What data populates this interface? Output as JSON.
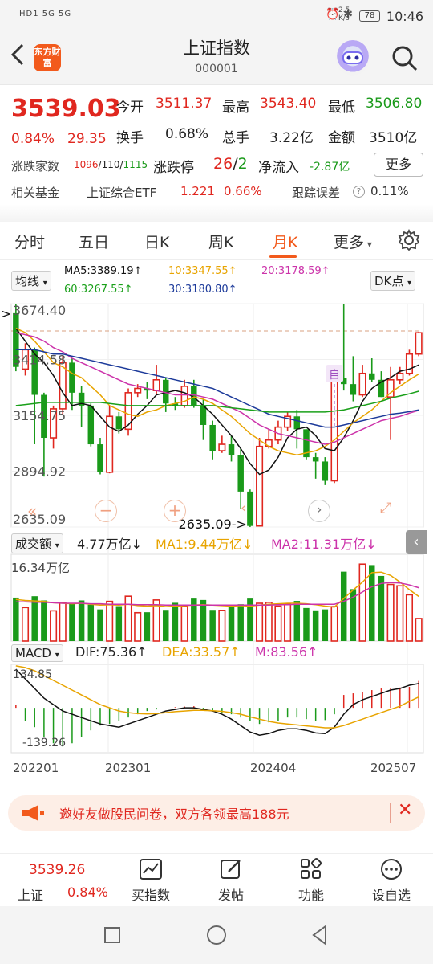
{
  "status": {
    "signal": "HD1 5G  5G",
    "speed": "2.5 K/s",
    "battery": "78",
    "time": "10:46"
  },
  "header": {
    "logo_text": "东方财富",
    "title": "上证指数",
    "code": "000001"
  },
  "quote": {
    "price": "3539.03",
    "change_pct": "0.84%",
    "change": "29.35",
    "open_label": "今开",
    "open": "3511.37",
    "high_label": "最高",
    "high": "3543.40",
    "low_label": "最低",
    "low": "3506.80",
    "turnover_label": "换手",
    "turnover": "0.68%",
    "volume_label": "总手",
    "volume": "3.22亿",
    "amount_label": "金额",
    "amount": "3510亿",
    "breadth_label": "涨跌家数",
    "breadth_up": "1096",
    "breadth_flat": "110",
    "breadth_down": "1115",
    "limit_label": "涨跌停",
    "limit_up": "26",
    "limit_down": "2",
    "netflow_label": "净流入",
    "netflow": "-2.87亿",
    "more_label": "更多"
  },
  "fund_row": {
    "label": "相关基金",
    "fund_name": "上证综合ETF",
    "fund_price": "1.221",
    "fund_pct": "0.66%",
    "track_label": "跟踪误差",
    "track_value": "0.11%"
  },
  "tabs": [
    {
      "label": "分时",
      "active": false
    },
    {
      "label": "五日",
      "active": false
    },
    {
      "label": "日K",
      "active": false
    },
    {
      "label": "周K",
      "active": false
    },
    {
      "label": "月K",
      "active": true
    },
    {
      "label": "更多",
      "active": false
    }
  ],
  "chart_controls": {
    "indicator_select": "均线",
    "dk_label": "DK点",
    "ma5": "MA5:3389.19↑",
    "ma10": "10:3347.55↑",
    "ma20": "20:3178.59↑",
    "ma60": "60:3267.55↑",
    "ma30": "30:3180.80↑",
    "marker": "自",
    "high_annotation": "3674.40->",
    "low_annotation": "2635.09->"
  },
  "volume_panel": {
    "select": "成交额",
    "value": "4.77万亿↓",
    "ma1": "MA1:9.44万亿↓",
    "ma2": "MA2:11.31万亿↓",
    "axis_top": "16.34万亿"
  },
  "macd_panel": {
    "select": "MACD",
    "dif": "DIF:75.36↑",
    "dea": "DEA:33.57↑",
    "m": "M:83.56↑",
    "axis_top": "134.85",
    "axis_bottom": "-139.26"
  },
  "banner": {
    "text": "邀好友做股民问卷，双方各领最高188元"
  },
  "bottom_nav": {
    "index_price": "3539.26",
    "index_name": "上证",
    "index_pct": "0.84%",
    "items": [
      {
        "label": "买指数",
        "icon": "chart-icon"
      },
      {
        "label": "发帖",
        "icon": "edit-icon"
      },
      {
        "label": "功能",
        "icon": "grid-icon"
      },
      {
        "label": "设自选",
        "icon": "more-icon"
      }
    ]
  },
  "colors": {
    "up": "#e0271f",
    "down": "#1a9a1a",
    "accent": "#f25a1c",
    "ma5": "#111111",
    "ma10": "#e8a400",
    "ma20": "#cc33aa",
    "ma30": "#1c3a9a",
    "ma60": "#1aa01a"
  },
  "chart_data": {
    "type": "candlestick",
    "title": "",
    "period": "monthly",
    "ylim": [
      2635.09,
      3674.4
    ],
    "y_ticks": [
      "3674.40",
      "3414.58",
      "3154.75",
      "2894.92",
      "2635.09"
    ],
    "x_ticks": [
      "202201",
      "202301",
      "202404",
      "202507"
    ],
    "candles": [
      {
        "o": 3630,
        "c": 3380,
        "h": 3674,
        "l": 3360
      },
      {
        "o": 3370,
        "c": 3460,
        "h": 3490,
        "l": 3340
      },
      {
        "o": 3460,
        "c": 3250,
        "h": 3470,
        "l": 3020
      },
      {
        "o": 3250,
        "c": 3050,
        "h": 3260,
        "l": 2870
      },
      {
        "o": 3050,
        "c": 3185,
        "h": 3200,
        "l": 3000
      },
      {
        "o": 3185,
        "c": 3400,
        "h": 3430,
        "l": 3160
      },
      {
        "o": 3400,
        "c": 3260,
        "h": 3420,
        "l": 3180
      },
      {
        "o": 3260,
        "c": 3200,
        "h": 3290,
        "l": 3100
      },
      {
        "o": 3200,
        "c": 3020,
        "h": 3210,
        "l": 3010
      },
      {
        "o": 3020,
        "c": 2890,
        "h": 3050,
        "l": 2880
      },
      {
        "o": 2890,
        "c": 3150,
        "h": 3200,
        "l": 2885
      },
      {
        "o": 3150,
        "c": 3090,
        "h": 3170,
        "l": 3070
      },
      {
        "o": 3090,
        "c": 3260,
        "h": 3280,
        "l": 3060
      },
      {
        "o": 3260,
        "c": 3280,
        "h": 3300,
        "l": 3240
      },
      {
        "o": 3280,
        "c": 3270,
        "h": 3310,
        "l": 3230
      },
      {
        "o": 3270,
        "c": 3320,
        "h": 3390,
        "l": 3250
      },
      {
        "o": 3320,
        "c": 3210,
        "h": 3330,
        "l": 3170
      },
      {
        "o": 3210,
        "c": 3200,
        "h": 3240,
        "l": 3180
      },
      {
        "o": 3200,
        "c": 3290,
        "h": 3320,
        "l": 3190
      },
      {
        "o": 3290,
        "c": 3200,
        "h": 3320,
        "l": 3190
      },
      {
        "o": 3200,
        "c": 3110,
        "h": 3230,
        "l": 3040
      },
      {
        "o": 3110,
        "c": 2990,
        "h": 3130,
        "l": 2950
      },
      {
        "o": 2990,
        "c": 3020,
        "h": 3060,
        "l": 2980
      },
      {
        "o": 3020,
        "c": 2970,
        "h": 3060,
        "l": 2940
      },
      {
        "o": 2970,
        "c": 2800,
        "h": 3000,
        "l": 2720
      },
      {
        "o": 2800,
        "c": 2640,
        "h": 2810,
        "l": 2635
      },
      {
        "o": 2640,
        "c": 3010,
        "h": 3050,
        "l": 2640
      },
      {
        "o": 3010,
        "c": 3040,
        "h": 3090,
        "l": 3000
      },
      {
        "o": 3040,
        "c": 3100,
        "h": 3130,
        "l": 3020
      },
      {
        "o": 3100,
        "c": 3150,
        "h": 3170,
        "l": 3080
      },
      {
        "o": 3150,
        "c": 3090,
        "h": 3180,
        "l": 3000
      },
      {
        "o": 3090,
        "c": 2960,
        "h": 3090,
        "l": 2950
      },
      {
        "o": 2960,
        "c": 2940,
        "h": 2980,
        "l": 2860
      },
      {
        "o": 2940,
        "c": 2850,
        "h": 2960,
        "l": 2830
      },
      {
        "o": 2850,
        "c": 3330,
        "h": 3370,
        "l": 2840
      },
      {
        "o": 3330,
        "c": 3300,
        "h": 3674,
        "l": 3270
      },
      {
        "o": 3300,
        "c": 3250,
        "h": 3430,
        "l": 3220
      },
      {
        "o": 3250,
        "c": 3350,
        "h": 3390,
        "l": 3240
      },
      {
        "o": 3350,
        "c": 3320,
        "h": 3420,
        "l": 3310
      },
      {
        "o": 3320,
        "c": 3240,
        "h": 3360,
        "l": 3240
      },
      {
        "o": 3240,
        "c": 3320,
        "h": 3380,
        "l": 3040
      },
      {
        "o": 3320,
        "c": 3350,
        "h": 3380,
        "l": 3300
      },
      {
        "o": 3350,
        "c": 3440,
        "h": 3460,
        "l": 3340
      },
      {
        "o": 3440,
        "c": 3539,
        "h": 3543,
        "l": 3430
      }
    ],
    "ma_series": [
      {
        "name": "MA5",
        "color": "#111111",
        "values": [
          3560,
          3500,
          3440,
          3400,
          3340,
          3260,
          3200,
          3210,
          3200,
          3150,
          3100,
          3080,
          3110,
          3160,
          3200,
          3250,
          3260,
          3270,
          3260,
          3240,
          3200,
          3160,
          3110,
          3060,
          3000,
          2930,
          2880,
          2900,
          2960,
          3050,
          3090,
          3100,
          3060,
          3000,
          2990,
          3050,
          3130,
          3220,
          3280,
          3310,
          3330,
          3360,
          3370,
          3389
        ]
      },
      {
        "name": "10",
        "color": "#e8a400",
        "values": [
          3560,
          3540,
          3500,
          3450,
          3400,
          3380,
          3350,
          3330,
          3290,
          3250,
          3200,
          3180,
          3160,
          3150,
          3170,
          3180,
          3200,
          3210,
          3220,
          3240,
          3230,
          3210,
          3180,
          3150,
          3110,
          3070,
          3040,
          3010,
          2990,
          2980,
          2970,
          2980,
          2990,
          3010,
          3040,
          3080,
          3120,
          3150,
          3180,
          3220,
          3260,
          3290,
          3320,
          3347
        ]
      },
      {
        "name": "20",
        "color": "#cc33aa",
        "values": [
          3540,
          3530,
          3520,
          3500,
          3470,
          3450,
          3420,
          3400,
          3380,
          3360,
          3340,
          3320,
          3300,
          3290,
          3280,
          3270,
          3260,
          3250,
          3250,
          3250,
          3240,
          3230,
          3210,
          3190,
          3170,
          3140,
          3110,
          3090,
          3070,
          3060,
          3050,
          3040,
          3030,
          3020,
          3030,
          3050,
          3070,
          3090,
          3110,
          3130,
          3140,
          3150,
          3165,
          3178
        ]
      },
      {
        "name": "30",
        "color": "#1c3a9a",
        "values": [
          3460,
          3460,
          3460,
          3450,
          3440,
          3440,
          3430,
          3420,
          3410,
          3400,
          3390,
          3380,
          3370,
          3360,
          3350,
          3340,
          3330,
          3320,
          3310,
          3300,
          3290,
          3280,
          3260,
          3240,
          3220,
          3200,
          3180,
          3160,
          3150,
          3140,
          3130,
          3120,
          3110,
          3100,
          3100,
          3110,
          3120,
          3130,
          3140,
          3150,
          3160,
          3165,
          3172,
          3180
        ]
      },
      {
        "name": "60",
        "color": "#1aa01a",
        "values": [
          3200,
          3205,
          3210,
          3215,
          3215,
          3215,
          3215,
          3215,
          3215,
          3215,
          3210,
          3205,
          3200,
          3200,
          3200,
          3200,
          3200,
          3200,
          3200,
          3200,
          3200,
          3200,
          3195,
          3190,
          3185,
          3180,
          3175,
          3170,
          3170,
          3170,
          3170,
          3170,
          3170,
          3170,
          3175,
          3180,
          3190,
          3200,
          3210,
          3220,
          3235,
          3245,
          3255,
          3267
        ]
      }
    ],
    "volume": [
      9.2,
      7.1,
      9.5,
      8.6,
      6.4,
      8.2,
      7.9,
      8.6,
      7.7,
      6.7,
      8.4,
      7.4,
      9.5,
      6.0,
      6.1,
      8.7,
      6.6,
      8.1,
      7.4,
      9.0,
      8.7,
      6.6,
      6.5,
      7.2,
      7.8,
      9.0,
      8.0,
      8.2,
      7.4,
      7.9,
      8.5,
      7.0,
      6.5,
      6.7,
      7.3,
      14.7,
      11.0,
      16.3,
      16.1,
      13.8,
      12.0,
      11.7,
      9.8,
      4.77
    ],
    "volume_ma1": [
      8.8,
      8.6,
      8.5,
      8.4,
      8.1,
      8.0,
      7.9,
      8.0,
      7.8,
      7.6,
      7.7,
      7.6,
      7.8,
      7.5,
      7.4,
      7.5,
      7.3,
      7.4,
      7.5,
      7.6,
      7.7,
      7.6,
      7.5,
      7.4,
      7.3,
      7.4,
      7.6,
      7.8,
      7.9,
      8.0,
      8.0,
      7.9,
      7.7,
      7.4,
      7.2,
      9.0,
      10.8,
      12.5,
      14.5,
      14.6,
      13.9,
      12.5,
      10.9,
      9.44
    ],
    "volume_ma2": [
      8.3,
      8.3,
      8.2,
      8.2,
      8.1,
      8.0,
      8.0,
      8.0,
      7.9,
      7.9,
      7.8,
      7.8,
      7.8,
      7.7,
      7.7,
      7.7,
      7.6,
      7.6,
      7.6,
      7.6,
      7.6,
      7.6,
      7.6,
      7.6,
      7.6,
      7.6,
      7.6,
      7.6,
      7.7,
      7.7,
      7.8,
      7.8,
      7.8,
      7.8,
      7.8,
      8.4,
      9.3,
      10.4,
      11.5,
      12.2,
      12.4,
      12.3,
      11.9,
      11.31
    ],
    "macd_hist": [
      10,
      -40,
      -60,
      -90,
      -110,
      -120,
      -110,
      -90,
      -70,
      -55,
      -50,
      -40,
      -30,
      -20,
      -10,
      -5,
      0,
      2,
      4,
      5,
      -5,
      -10,
      -15,
      -20,
      -30,
      -40,
      -50,
      -45,
      -40,
      -30,
      -30,
      -35,
      -40,
      -38,
      -20,
      40,
      45,
      50,
      55,
      60,
      62,
      63,
      65,
      83.56
    ],
    "macd_dif": [
      120,
      90,
      60,
      30,
      10,
      -10,
      -20,
      -30,
      -40,
      -50,
      -55,
      -60,
      -50,
      -40,
      -30,
      -20,
      -10,
      -5,
      0,
      0,
      -5,
      -10,
      -20,
      -35,
      -55,
      -75,
      -85,
      -80,
      -70,
      -65,
      -65,
      -70,
      -78,
      -80,
      -60,
      -20,
      10,
      25,
      35,
      45,
      55,
      60,
      70,
      75.36
    ],
    "macd_dea": [
      130,
      125,
      115,
      100,
      85,
      70,
      55,
      40,
      25,
      10,
      0,
      -10,
      -15,
      -18,
      -19,
      -18,
      -15,
      -12,
      -10,
      -8,
      -8,
      -9,
      -11,
      -15,
      -20,
      -28,
      -35,
      -42,
      -47,
      -50,
      -53,
      -56,
      -59,
      -62,
      -62,
      -55,
      -45,
      -35,
      -25,
      -15,
      -5,
      5,
      20,
      33.57
    ]
  }
}
